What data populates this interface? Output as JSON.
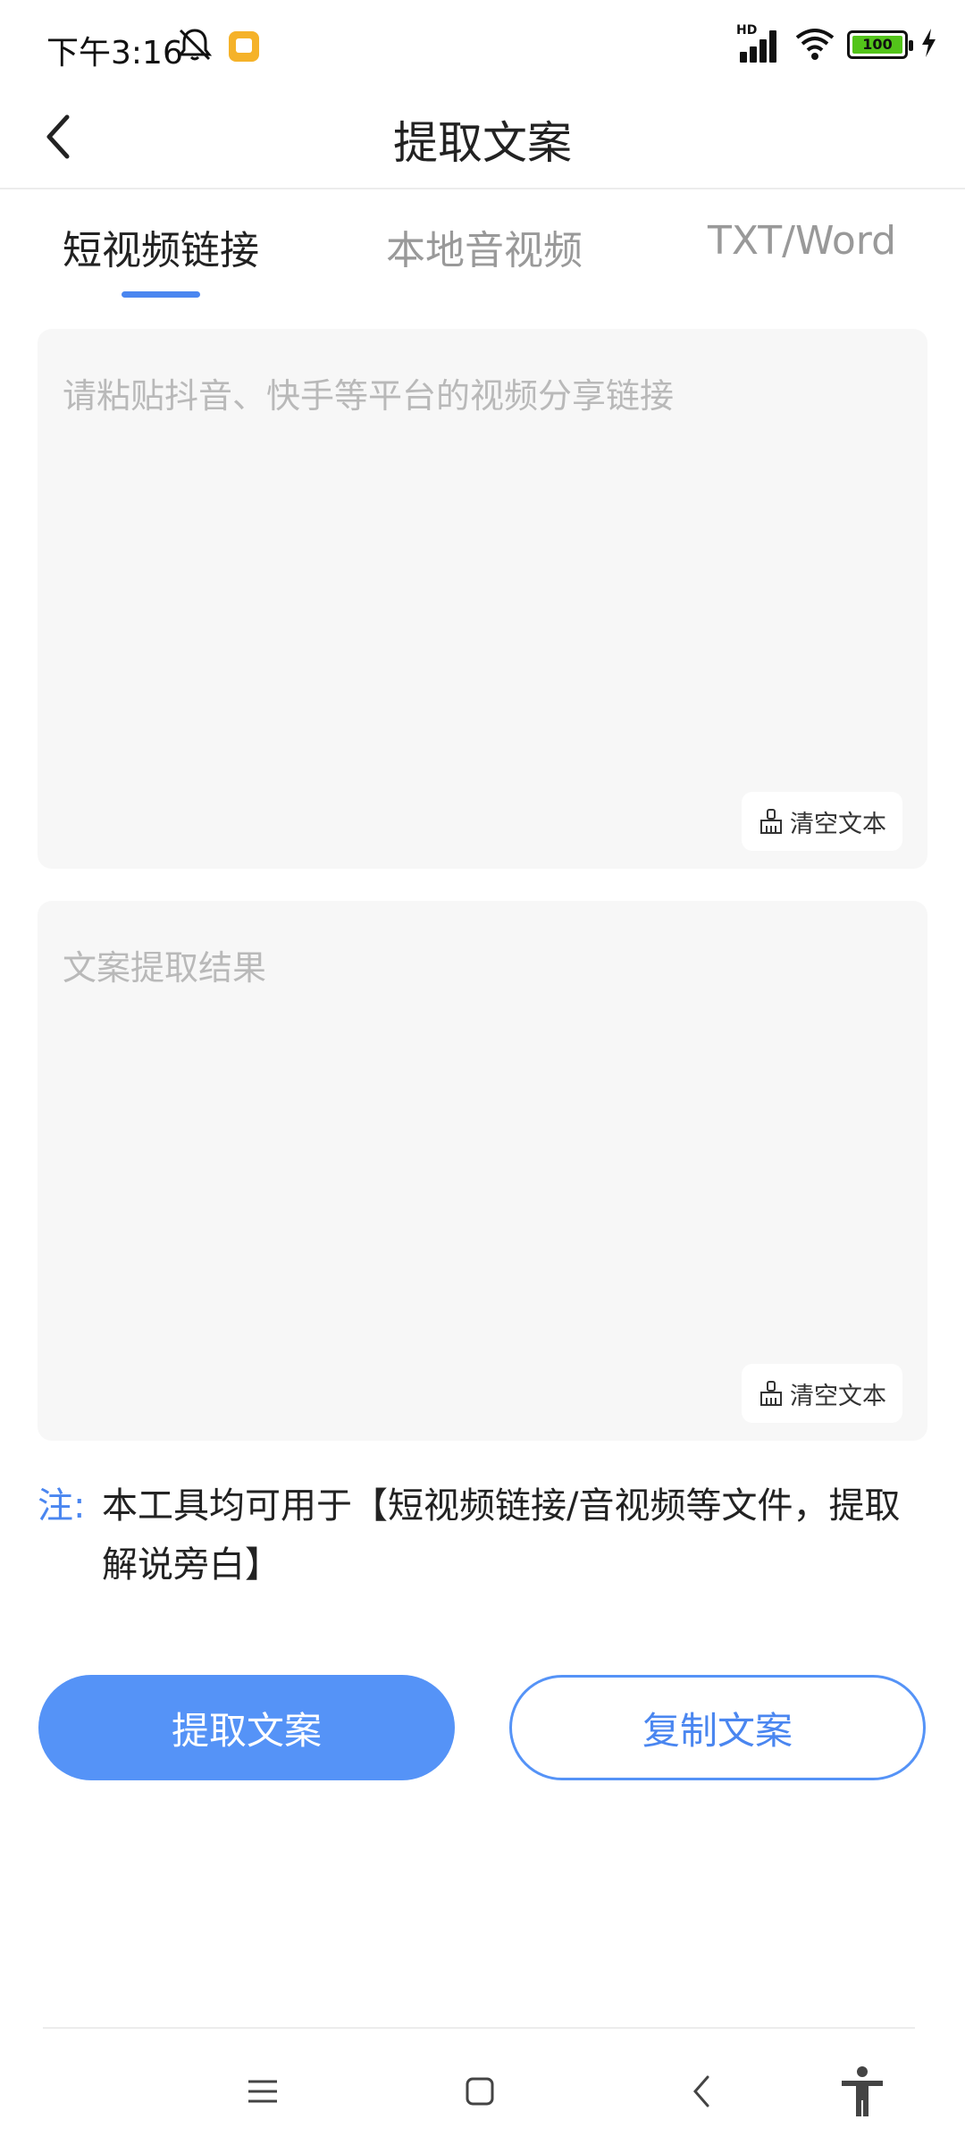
{
  "status_bar": {
    "time": "下午3:16",
    "hd_label": "HD",
    "battery_level": "100",
    "icons": [
      "mute-icon",
      "message-icon",
      "signal-icon",
      "wifi-icon",
      "battery-icon",
      "charging-icon"
    ]
  },
  "header": {
    "title": "提取文案",
    "back_icon": "chevron-left-icon"
  },
  "tabs": [
    {
      "label": "短视频链接",
      "active": true
    },
    {
      "label": "本地音视频",
      "active": false
    },
    {
      "label": "TXT/Word",
      "active": false
    }
  ],
  "link_input": {
    "placeholder": "请粘贴抖音、快手等平台的视频分享链接",
    "value": "",
    "clear_label": "清空文本"
  },
  "result_output": {
    "placeholder": "文案提取结果",
    "value": "",
    "clear_label": "清空文本"
  },
  "note": {
    "label": "注:",
    "text": "本工具均可用于【短视频链接/音视频等文件，提取解说旁白】"
  },
  "actions": {
    "extract_label": "提取文案",
    "copy_label": "复制文案"
  },
  "colors": {
    "accent": "#4a86f0",
    "primary_button": "#5593f7",
    "panel_bg": "#f7f7f7",
    "placeholder": "#b9b9b9"
  },
  "nav": {
    "icons": [
      "menu-icon",
      "home-square-icon",
      "back-icon",
      "accessibility-icon"
    ]
  }
}
